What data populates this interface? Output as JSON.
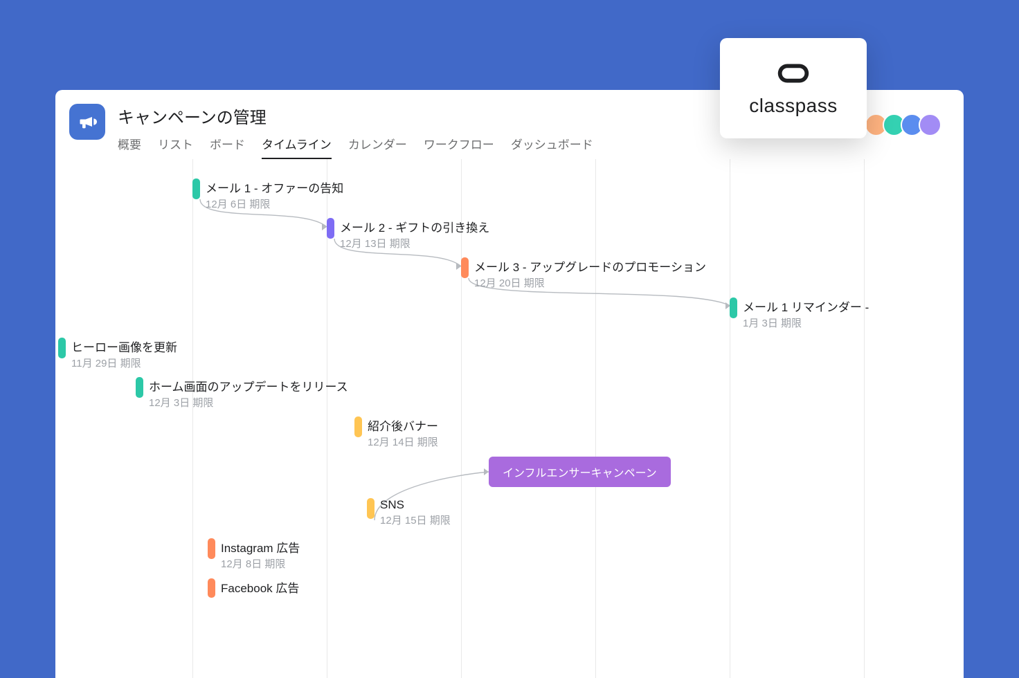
{
  "project": {
    "title": "キャンペーンの管理"
  },
  "tabs": [
    {
      "label": "概要"
    },
    {
      "label": "リスト"
    },
    {
      "label": "ボード"
    },
    {
      "label": "タイムライン",
      "active": true
    },
    {
      "label": "カレンダー"
    },
    {
      "label": "ワークフロー"
    },
    {
      "label": "ダッシュボード"
    }
  ],
  "overlay": {
    "logo_text": "classpass"
  },
  "tasks": {
    "t1": {
      "title": "メール 1 - オファーの告知",
      "due": "12月 6日 期限",
      "color": "teal"
    },
    "t2": {
      "title": "メール 2 - ギフトの引き換え",
      "due": "12月 13日 期限",
      "color": "purple"
    },
    "t3": {
      "title": "メール 3 - アップグレードのプロモーション",
      "due": "12月 20日 期限",
      "color": "orange"
    },
    "t4": {
      "title": "メール 1 リマインダー - ",
      "due": "1月 3日 期限",
      "color": "teal"
    },
    "t5": {
      "title": "ヒーロー画像を更新",
      "due": "11月 29日 期限",
      "color": "teal"
    },
    "t6": {
      "title": "ホーム画面のアップデートをリリース",
      "due": "12月 3日 期限",
      "color": "teal"
    },
    "t7": {
      "title": "紹介後バナー",
      "due": "12月 14日 期限",
      "color": "yellow"
    },
    "t8": {
      "title": "インフルエンサーキャンペーン",
      "color": "block"
    },
    "t9": {
      "title": "SNS",
      "due": "12月 15日 期限",
      "color": "yellow"
    },
    "t10": {
      "title": "Instagram 広告",
      "due": "12月 8日 期限",
      "color": "orange"
    },
    "t11": {
      "title": "Facebook 広告",
      "due": "",
      "color": "orange"
    }
  }
}
